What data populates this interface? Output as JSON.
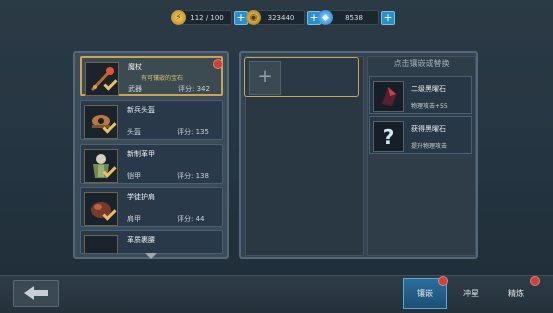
{
  "resources": {
    "energy": {
      "icon": "lightning-icon",
      "value": "112 / 100"
    },
    "gold": {
      "icon": "gold-coin-icon",
      "value": "323440"
    },
    "diamond": {
      "icon": "diamond-icon",
      "value": "8538"
    }
  },
  "equipment": [
    {
      "name": "魔杖",
      "sub": "有可镶嵌的宝石",
      "type": "武器",
      "score": "评分: 342",
      "selected": true
    },
    {
      "name": "新兵头盔",
      "type": "头盔",
      "score": "评分: 135"
    },
    {
      "name": "新制革甲",
      "type": "铠甲",
      "score": "评分: 138"
    },
    {
      "name": "学徒护肩",
      "type": "肩甲",
      "score": "评分: 44"
    },
    {
      "name": "革质裹腰"
    }
  ],
  "hint": "点击镶嵌或替换",
  "gems": [
    {
      "name": "二级黑曜石",
      "desc": "物理攻击+55"
    },
    {
      "name": "获得黑曜石",
      "desc": "提升物理攻击"
    }
  ],
  "tabs": {
    "inlay": "镶嵌",
    "upgrade": "冲星",
    "refine": "精炼"
  },
  "colors": {
    "accent_gold": "#c9a55a",
    "tab_active": "#2a6d9c",
    "red_dot": "#c9423b"
  }
}
